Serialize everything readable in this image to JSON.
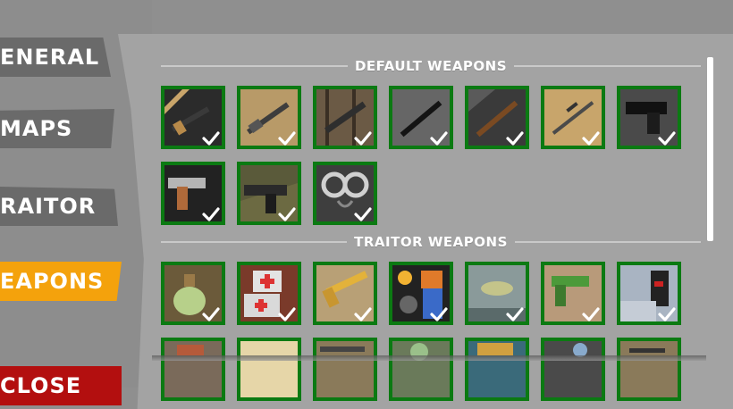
{
  "sidebar": {
    "tabs": [
      {
        "id": "general",
        "label": "ENERAL"
      },
      {
        "id": "maps",
        "label": "MAPS"
      },
      {
        "id": "traitor",
        "label": "RAITOR"
      },
      {
        "id": "weapons",
        "label": "EAPONS",
        "active": true
      },
      {
        "id": "close",
        "label": "CLOSE"
      }
    ]
  },
  "colors": {
    "active_tab": "#f4a20c",
    "close_tab": "#b30f0f",
    "slot_border": "#0b7a12",
    "panel_bg": "#a3a3a3"
  },
  "sections": {
    "default": {
      "title": "DEFAULT WEAPONS"
    },
    "traitor": {
      "title": "TRAITOR WEAPONS"
    }
  },
  "default_weapons": [
    {
      "icon": "assault-rifle-icon",
      "selected": true
    },
    {
      "icon": "assault-rifle-scoped-icon",
      "selected": true
    },
    {
      "icon": "carbine-icon",
      "selected": true
    },
    {
      "icon": "black-rifle-icon",
      "selected": true
    },
    {
      "icon": "wooden-rifle-icon",
      "selected": true
    },
    {
      "icon": "sniper-rifle-icon",
      "selected": true
    },
    {
      "icon": "black-pistol-icon",
      "selected": true
    },
    {
      "icon": "1911-pistol-icon",
      "selected": true
    },
    {
      "icon": "desert-eagle-icon",
      "selected": true
    },
    {
      "icon": "handcuffs-icon",
      "selected": true
    }
  ],
  "traitor_weapons": [
    {
      "icon": "potion-bottle-icon",
      "selected": true
    },
    {
      "icon": "medkit-icon",
      "selected": true
    },
    {
      "icon": "golden-revolver-icon",
      "selected": true
    },
    {
      "icon": "bomb-character-icon",
      "selected": true
    },
    {
      "icon": "landmine-icon",
      "selected": true
    },
    {
      "icon": "green-pistol-icon",
      "selected": true
    },
    {
      "icon": "c4-device-icon",
      "selected": true
    }
  ],
  "traitor_weapons_row2": [
    {
      "icon": "partial-item-1-icon"
    },
    {
      "icon": "partial-item-2-icon"
    },
    {
      "icon": "partial-item-3-icon"
    },
    {
      "icon": "partial-item-4-icon"
    },
    {
      "icon": "partial-item-5-icon"
    },
    {
      "icon": "partial-item-6-icon"
    },
    {
      "icon": "partial-item-7-icon"
    }
  ]
}
